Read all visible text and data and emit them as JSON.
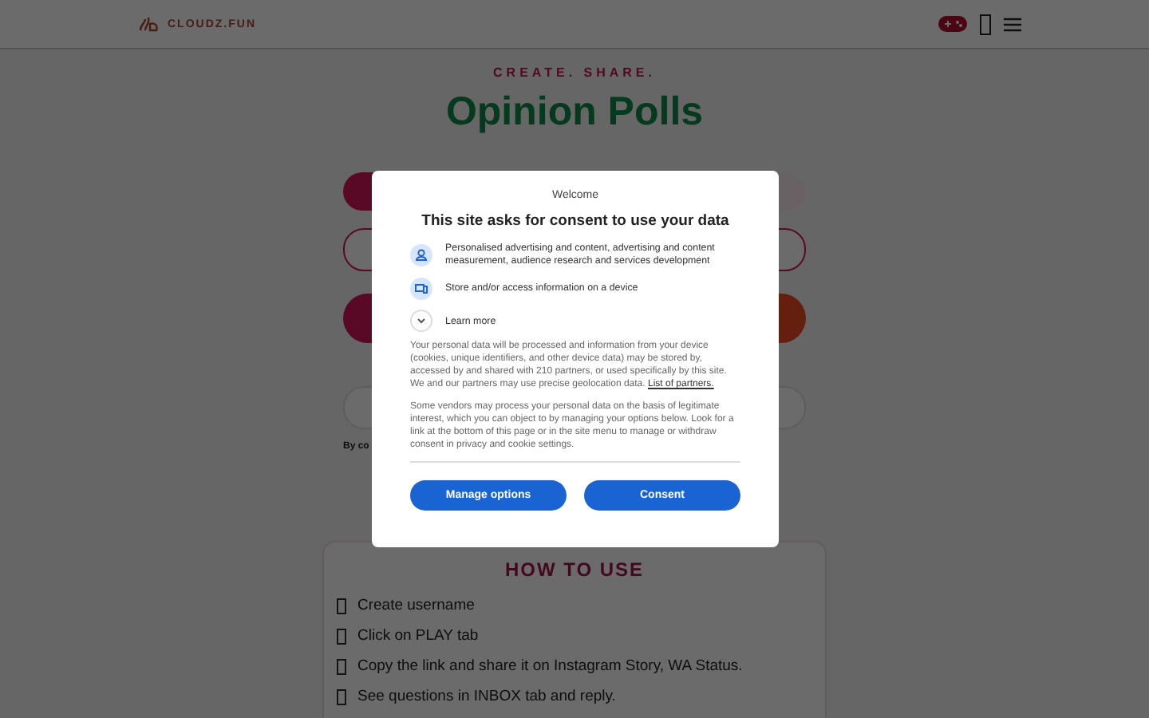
{
  "header": {
    "logo_text": "CLOUDZ.FUN"
  },
  "hero": {
    "tagline": "CREATE. SHARE.",
    "title": "Opinion Polls"
  },
  "form": {
    "note": "By co"
  },
  "how_to": {
    "title": "HOW TO USE",
    "steps": [
      "Create username",
      "Click on PLAY tab",
      "Copy the link and share it on Instagram Story, WA Status.",
      "See questions in INBOX tab and reply."
    ]
  },
  "consent": {
    "welcome": "Welcome",
    "title": "This site asks for consent to use your data",
    "purposes": [
      {
        "kind": "person",
        "text": "Personalised advertising and content, advertising and content measurement, audience research and services development"
      },
      {
        "kind": "device",
        "text": "Store and/or access information on a device"
      }
    ],
    "learn_more": {
      "label": "Learn more",
      "expanded": false
    },
    "paragraph_1": "Your personal data will be processed and information from your device (cookies, unique identifiers, and other device data) may be stored by, accessed by and shared with 210 partners, or used specifically by this site. We and our partners may use precise geolocation data.",
    "link": "List of partners.",
    "paragraph_2": "Some vendors may process your personal data on the basis of legitimate interest, which you can object to by managing your options below. Look for a link at the bottom of this page or in the site menu to manage or withdraw consent in privacy and cookie settings.",
    "buttons": [
      "Manage options",
      "Consent"
    ]
  }
}
